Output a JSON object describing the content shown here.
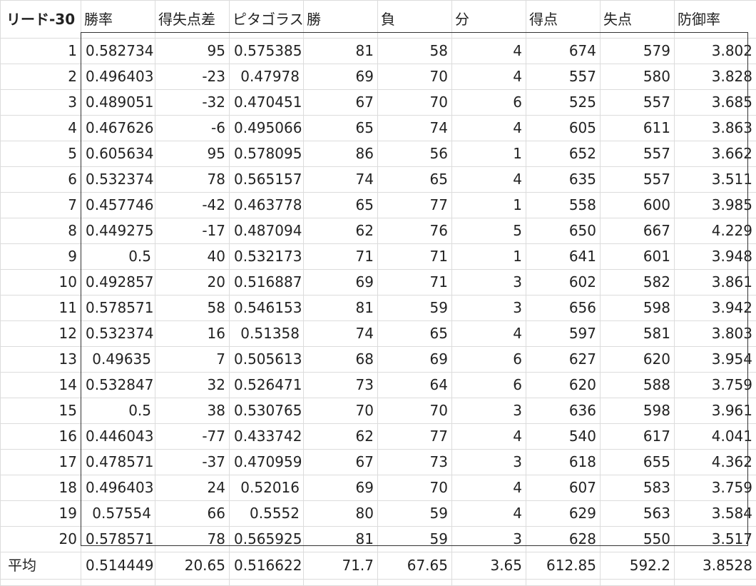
{
  "headers": [
    "リード-30",
    "勝率",
    "得失点差",
    "ピタゴラス",
    "勝",
    "負",
    "分",
    "得点",
    "失点",
    "防御率"
  ],
  "rows": [
    [
      "1",
      "0.582734",
      "95",
      "0.575385",
      "81",
      "58",
      "4",
      "674",
      "579",
      "3.802"
    ],
    [
      "2",
      "0.496403",
      "-23",
      "0.47978",
      "69",
      "70",
      "4",
      "557",
      "580",
      "3.828"
    ],
    [
      "3",
      "0.489051",
      "-32",
      "0.470451",
      "67",
      "70",
      "6",
      "525",
      "557",
      "3.685"
    ],
    [
      "4",
      "0.467626",
      "-6",
      "0.495066",
      "65",
      "74",
      "4",
      "605",
      "611",
      "3.863"
    ],
    [
      "5",
      "0.605634",
      "95",
      "0.578095",
      "86",
      "56",
      "1",
      "652",
      "557",
      "3.662"
    ],
    [
      "6",
      "0.532374",
      "78",
      "0.565157",
      "74",
      "65",
      "4",
      "635",
      "557",
      "3.511"
    ],
    [
      "7",
      "0.457746",
      "-42",
      "0.463778",
      "65",
      "77",
      "1",
      "558",
      "600",
      "3.985"
    ],
    [
      "8",
      "0.449275",
      "-17",
      "0.487094",
      "62",
      "76",
      "5",
      "650",
      "667",
      "4.229"
    ],
    [
      "9",
      "0.5",
      "40",
      "0.532173",
      "71",
      "71",
      "1",
      "641",
      "601",
      "3.948"
    ],
    [
      "10",
      "0.492857",
      "20",
      "0.516887",
      "69",
      "71",
      "3",
      "602",
      "582",
      "3.861"
    ],
    [
      "11",
      "0.578571",
      "58",
      "0.546153",
      "81",
      "59",
      "3",
      "656",
      "598",
      "3.942"
    ],
    [
      "12",
      "0.532374",
      "16",
      "0.51358",
      "74",
      "65",
      "4",
      "597",
      "581",
      "3.803"
    ],
    [
      "13",
      "0.49635",
      "7",
      "0.505613",
      "68",
      "69",
      "6",
      "627",
      "620",
      "3.954"
    ],
    [
      "14",
      "0.532847",
      "32",
      "0.526471",
      "73",
      "64",
      "6",
      "620",
      "588",
      "3.759"
    ],
    [
      "15",
      "0.5",
      "38",
      "0.530765",
      "70",
      "70",
      "3",
      "636",
      "598",
      "3.961"
    ],
    [
      "16",
      "0.446043",
      "-77",
      "0.433742",
      "62",
      "77",
      "4",
      "540",
      "617",
      "4.041"
    ],
    [
      "17",
      "0.478571",
      "-37",
      "0.470959",
      "67",
      "73",
      "3",
      "618",
      "655",
      "4.362"
    ],
    [
      "18",
      "0.496403",
      "24",
      "0.52016",
      "69",
      "70",
      "4",
      "607",
      "583",
      "3.759"
    ],
    [
      "19",
      "0.57554",
      "66",
      "0.5552",
      "80",
      "59",
      "4",
      "629",
      "563",
      "3.584"
    ],
    [
      "20",
      "0.578571",
      "78",
      "0.565925",
      "81",
      "59",
      "3",
      "628",
      "550",
      "3.517"
    ]
  ],
  "average": [
    "平均",
    "0.514449",
    "20.65",
    "0.516622",
    "71.7",
    "67.65",
    "3.65",
    "612.85",
    "592.2",
    "3.8528"
  ]
}
